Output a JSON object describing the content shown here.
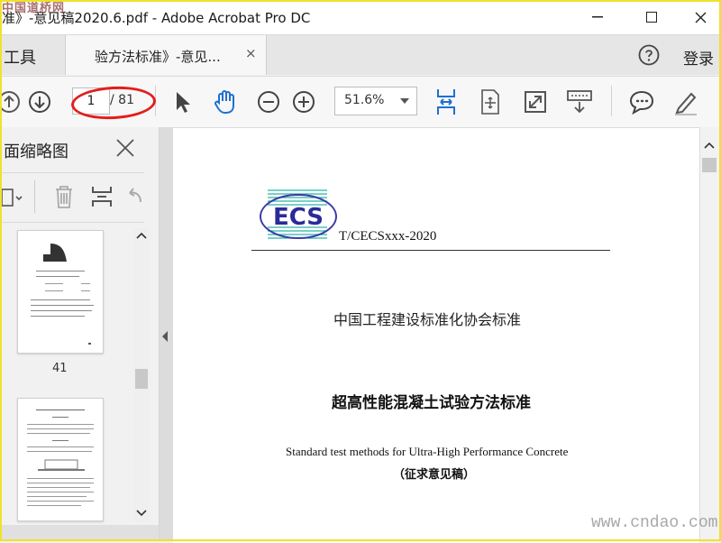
{
  "window": {
    "title": "准》-意见稿2020.6.pdf - Adobe Acrobat Pro DC",
    "watermark_top": "中国道桥网"
  },
  "tabs": {
    "tools_label": "工具",
    "doc_tab_label": "验方法标准》-意见...",
    "close_glyph": "×",
    "login_label": "登录"
  },
  "toolbar": {
    "page_current": "1",
    "page_total": "/ 81",
    "zoom": "51.6%"
  },
  "left_panel": {
    "title": "面缩略图",
    "thumb_page_label": "41"
  },
  "document": {
    "logo_text": "ECS",
    "standard_code": "T/CECSxxx-2020",
    "association": "中国工程建设标准化协会标准",
    "title_cn": "超高性能混凝土试验方法标准",
    "title_en": "Standard test methods for Ultra-High Performance Concrete",
    "draft_note": "（征求意见稿）"
  },
  "watermark_bottom": "www.cndao.com"
}
